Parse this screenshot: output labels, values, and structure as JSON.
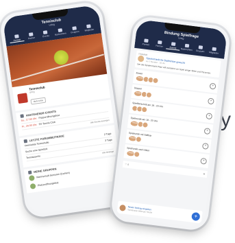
{
  "background_text": {
    "line1": "",
    "line2": "y"
  },
  "back_phone": {
    "title": "Tennisclub",
    "subtitle": "Urbig",
    "nav": [
      "Portrait",
      "Partner",
      "Events",
      "Nachrichten",
      "Gruppen",
      "Mitglieder"
    ],
    "club": {
      "name": "Tennisclub",
      "sub": "Urbig",
      "button": "Mehr Infos"
    },
    "events": {
      "heading": "ANSTEHENDE EVENTS",
      "items": [
        {
          "date": "So., 17:00 Uhr",
          "name": "Platzeröffnungsfest"
        },
        {
          "date": "Fr., 20:00 Uhr",
          "name": "SV Tennis Club"
        }
      ],
      "link": "Alle Events anzeigen"
    },
    "posts": {
      "heading": "LETZTE FORUMBEITRÄGE",
      "items": [
        {
          "name": "Vermietete Tennishalle",
          "meta": "2 Tage"
        },
        {
          "name": "Suche eine Spielzeit",
          "meta": "3 Tage"
        },
        {
          "name": "Tennistasche",
          "meta": ""
        }
      ],
      "link": "Alle Beiträge"
    },
    "groups": {
      "heading": "MEINE GRUPPEN",
      "items": [
        {
          "name": "Mannschaft Senioren (Damen)"
        },
        {
          "name": "Platzeröffnungsfest"
        }
      ]
    }
  },
  "front_phone": {
    "title": "Bindung Spielfrage",
    "subtitle": "Urbig",
    "nav": [
      "Portrait",
      "Partner",
      "Events",
      "Nachrichten",
      "Gruppen",
      "Mitglieder"
    ],
    "post": {
      "label": "TERMINE",
      "author": "Spielermarkt für Badminton gesucht",
      "time": "vor 2 Stunden · 16 Uhr",
      "text": "Der die Spielermarkt Platz will zunächst vor Spiel einige Teller und Personen."
    },
    "matches": [
      {
        "label": "Einzel",
        "tag": "Heute"
      },
      {
        "label": "Doppel",
        "tag": "Heute"
      },
      {
        "label": "Spielfortschritt am 18 - 20 Uhr",
        "tag": ""
      },
      {
        "label": "Spielrunde am 18 - 20 Uhr",
        "tag": "Heute"
      },
      {
        "label": "Spielrunde mit Saftbar",
        "tag": "Heute"
      },
      {
        "label": "Spielrunde nach Biker",
        "tag": "Heute"
      },
      {
        "label": "",
        "tag": ""
      }
    ],
    "composer_text": "Neuen Beitrag eingeben",
    "composer_sub": "Spielgruppe Bitburger Straße",
    "fab_label": "+"
  }
}
